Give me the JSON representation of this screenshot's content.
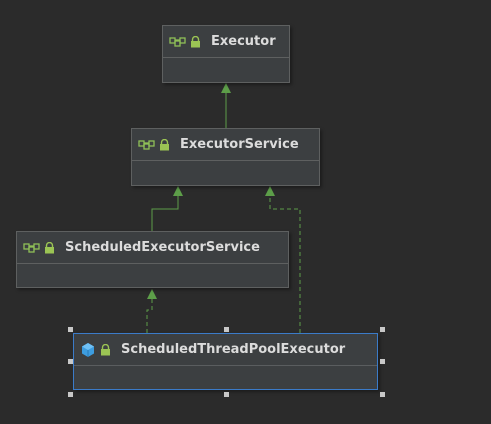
{
  "diagram": {
    "nodes": [
      {
        "id": "executor",
        "title": "Executor",
        "kind": "interface",
        "icons": [
          "interface-icon",
          "lock-icon"
        ]
      },
      {
        "id": "executor_service",
        "title": "ExecutorService",
        "kind": "interface",
        "icons": [
          "interface-icon",
          "lock-icon"
        ]
      },
      {
        "id": "scheduled_executor_service",
        "title": "ScheduledExecutorService",
        "kind": "interface",
        "icons": [
          "interface-icon",
          "lock-icon"
        ]
      },
      {
        "id": "scheduled_thread_pool_executor",
        "title": "ScheduledThreadPoolExecutor",
        "kind": "class",
        "selected": true,
        "icons": [
          "class-icon",
          "lock-icon"
        ]
      }
    ],
    "edges": [
      {
        "from": "executor_service",
        "to": "executor",
        "style": "solid",
        "meaning": "extends"
      },
      {
        "from": "scheduled_executor_service",
        "to": "executor_service",
        "style": "solid",
        "meaning": "extends"
      },
      {
        "from": "scheduled_thread_pool_executor",
        "to": "scheduled_executor_service",
        "style": "dashed",
        "meaning": "implements"
      },
      {
        "from": "scheduled_thread_pool_executor",
        "to": "executor_service",
        "style": "dashed",
        "meaning": "implements"
      }
    ],
    "colors": {
      "background": "#2b2b2b",
      "node_fill": "#3c3f41",
      "edge": "#5d9e49",
      "interface_icon": "#8fc057",
      "class_icon": "#3d9de0",
      "lock_icon": "#9bc454",
      "selection": "#3b7bc8"
    }
  }
}
